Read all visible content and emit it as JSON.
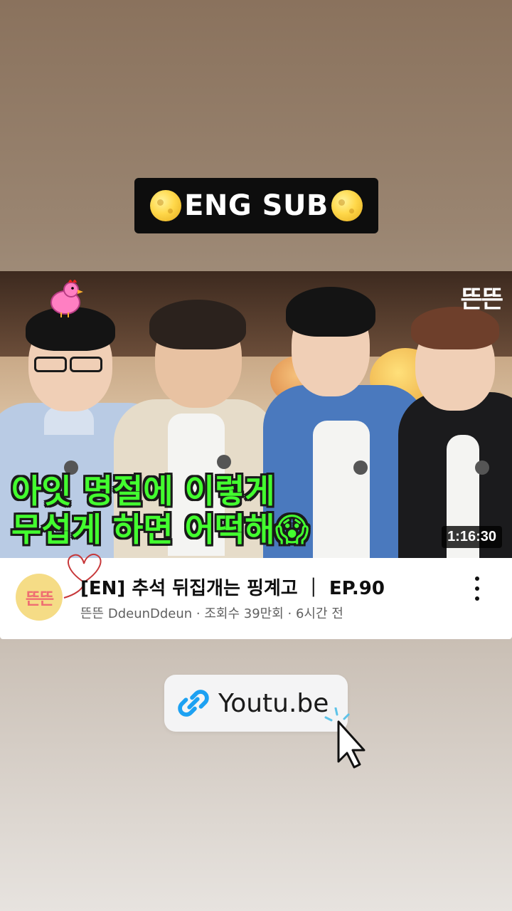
{
  "badge": {
    "text": "ENG SUB"
  },
  "thumbnail": {
    "logo": "뜬뜬",
    "caption_line1": "아잇 명절에 이렇게",
    "caption_line2": "무섭게 하면 어떡해😱",
    "duration": "1:16:30"
  },
  "video": {
    "channel_avatar_text": "뜬뜬",
    "title": "[EN] 추석 뒤집개는 핑계고 ｜ EP.90",
    "meta": "뜬뜬 DdeunDdeun · 조회수 39만회 · 6시간 전"
  },
  "link": {
    "label": "Youtu.be"
  },
  "icons": {
    "moon": "full-moon-icon",
    "more": "more-vert-icon",
    "link": "link-icon",
    "cursor": "cursor-icon",
    "heart": "heart-doodle-icon",
    "hen": "hen-sticker-icon"
  },
  "colors": {
    "caption": "#43ff2f",
    "link_icon": "#1da1f2",
    "badge_bg": "#0d0d0d"
  }
}
